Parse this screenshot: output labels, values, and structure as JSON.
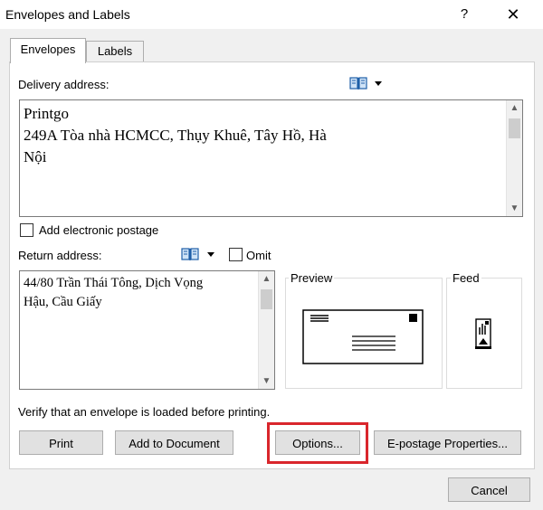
{
  "window": {
    "title": "Envelopes and Labels",
    "help_glyph": "?",
    "close_glyph": "✕"
  },
  "tabs": [
    {
      "label": "Envelopes",
      "active": true
    },
    {
      "label": "Labels",
      "active": false
    }
  ],
  "delivery": {
    "label": "Delivery address:",
    "text": "Printgo\n249A Tòa nhà HCMCC, Thụy Khuê, Tây Hồ, Hà\nNội"
  },
  "postage": {
    "label": "Add electronic postage",
    "checked": false
  },
  "return": {
    "label": "Return address:",
    "omit_label": "Omit",
    "omit_checked": false,
    "text": "44/80 Trần Thái Tông, Dịch Vọng\nHậu, Cầu Giấy"
  },
  "preview": {
    "label": "Preview"
  },
  "feed": {
    "label": "Feed"
  },
  "verify_text": "Verify that an envelope is loaded before printing.",
  "buttons": {
    "print": "Print",
    "add_to_document": "Add to Document",
    "options": "Options...",
    "epostage": "E-postage Properties...",
    "cancel": "Cancel"
  },
  "icons": {
    "address_book": "address-book-icon",
    "dropdown": "chevron-down-icon",
    "scroll_up": "▲",
    "scroll_down": "▼"
  },
  "colors": {
    "highlight": "#d9262c",
    "dialog_bg": "#f0f0f0"
  }
}
